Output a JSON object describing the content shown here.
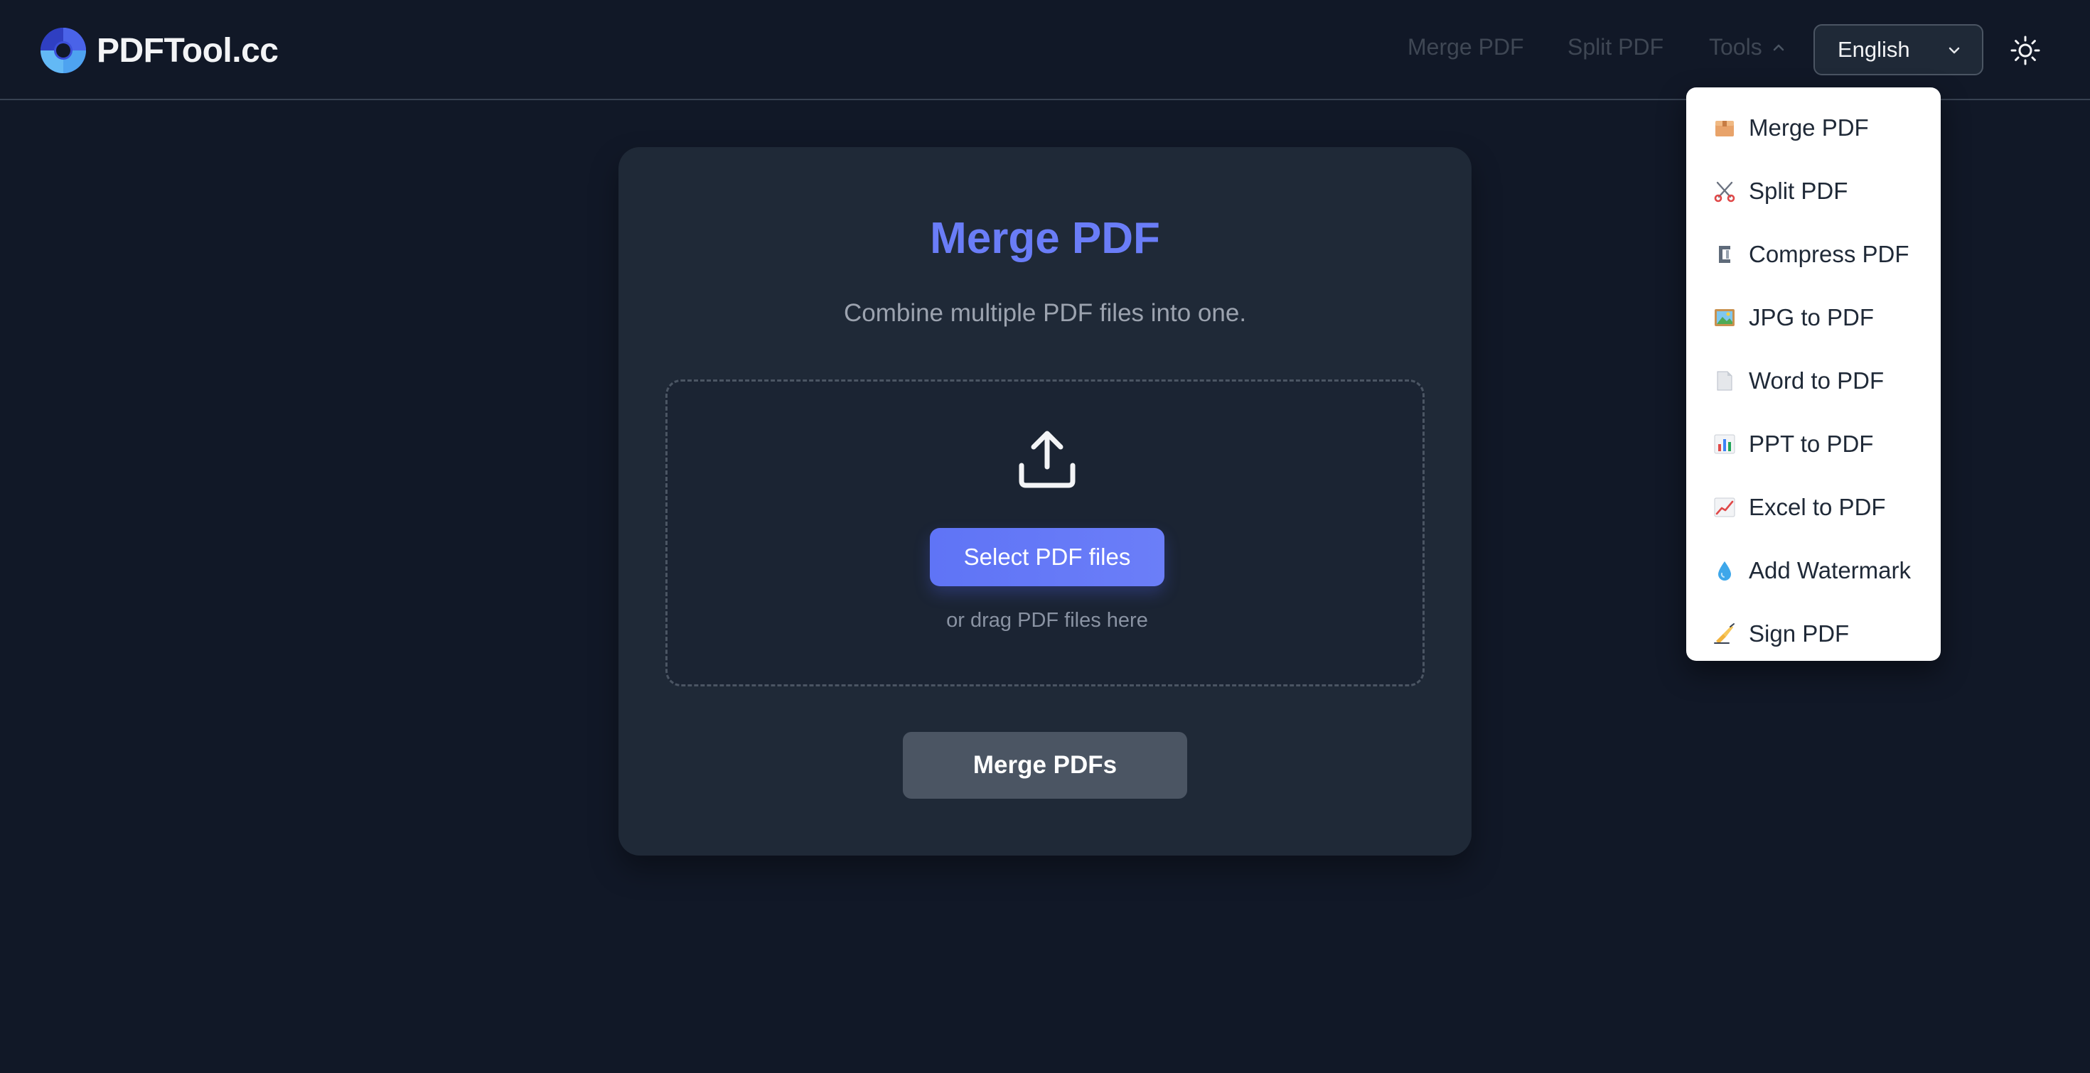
{
  "brand": {
    "name": "PDFTool.cc",
    "icon": "aperture-logo-icon"
  },
  "nav": {
    "merge_label": "Merge PDF",
    "split_label": "Split PDF",
    "tools_label": "Tools"
  },
  "language": {
    "selected": "English"
  },
  "theme_toggle": {
    "icon": "sun-icon"
  },
  "card": {
    "title": "Merge PDF",
    "subtitle": "Combine multiple PDF files into one.",
    "dropzone": {
      "icon": "upload-icon",
      "select_label": "Select PDF files",
      "hint": "or drag PDF files here"
    },
    "action_label": "Merge PDFs"
  },
  "tools_menu": {
    "items": [
      {
        "label": "Merge PDF",
        "icon": "package-icon"
      },
      {
        "label": "Split PDF",
        "icon": "scissors-icon"
      },
      {
        "label": "Compress PDF",
        "icon": "clamp-icon"
      },
      {
        "label": "JPG to PDF",
        "icon": "framed-picture-icon"
      },
      {
        "label": "Word to PDF",
        "icon": "page-icon"
      },
      {
        "label": "PPT to PDF",
        "icon": "bar-chart-icon"
      },
      {
        "label": "Excel to PDF",
        "icon": "line-chart-icon"
      },
      {
        "label": "Add Watermark",
        "icon": "droplet-icon"
      },
      {
        "label": "Sign PDF",
        "icon": "writing-hand-icon"
      }
    ]
  },
  "colors": {
    "background": "#111827",
    "card": "#1f2937",
    "accent": "#6a7df7",
    "muted_button": "#4b5563"
  }
}
